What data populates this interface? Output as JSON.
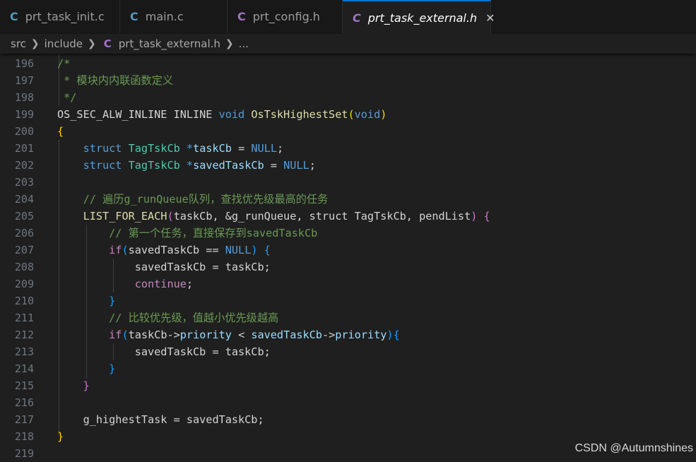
{
  "tabs": [
    {
      "icon": "C",
      "label": "prt_task_init.c",
      "active": false
    },
    {
      "icon": "C",
      "label": "main.c",
      "active": false
    },
    {
      "icon": "C",
      "label": "prt_config.h",
      "active": false
    },
    {
      "icon": "C",
      "label": "prt_task_external.h",
      "active": true,
      "close": "✕"
    }
  ],
  "breadcrumb": {
    "items": [
      "src",
      "include",
      "prt_task_external.h",
      "..."
    ],
    "file_icon": "C"
  },
  "editor": {
    "lines": [
      {
        "n": "196",
        "tokens": [
          [
            "c",
            "/*"
          ]
        ]
      },
      {
        "n": "197",
        "tokens": [
          [
            "c",
            " * 模块内内联函数定义"
          ]
        ]
      },
      {
        "n": "198",
        "tokens": [
          [
            "c",
            " */"
          ]
        ]
      },
      {
        "n": "199",
        "tokens": [
          [
            "p",
            "OS_SEC_ALW_INLINE INLINE "
          ],
          [
            "k",
            "void"
          ],
          [
            "p",
            " "
          ],
          [
            "f",
            "OsTskHighestSet"
          ],
          [
            "b1",
            "("
          ],
          [
            "k",
            "void"
          ],
          [
            "b1",
            ")"
          ]
        ]
      },
      {
        "n": "200",
        "tokens": [
          [
            "b1",
            "{"
          ]
        ]
      },
      {
        "n": "201",
        "tokens": [
          [
            "p",
            "    "
          ],
          [
            "k",
            "struct"
          ],
          [
            "p",
            " "
          ],
          [
            "t",
            "TagTskCb"
          ],
          [
            "p",
            " "
          ],
          [
            "k",
            "*"
          ],
          [
            "v",
            "taskCb"
          ],
          [
            "p",
            " = "
          ],
          [
            "k",
            "NULL"
          ],
          [
            "p",
            ";"
          ]
        ]
      },
      {
        "n": "202",
        "tokens": [
          [
            "p",
            "    "
          ],
          [
            "k",
            "struct"
          ],
          [
            "p",
            " "
          ],
          [
            "t",
            "TagTskCb"
          ],
          [
            "p",
            " "
          ],
          [
            "k",
            "*"
          ],
          [
            "v",
            "savedTaskCb"
          ],
          [
            "p",
            " = "
          ],
          [
            "k",
            "NULL"
          ],
          [
            "p",
            ";"
          ]
        ]
      },
      {
        "n": "203",
        "tokens": []
      },
      {
        "n": "204",
        "tokens": [
          [
            "p",
            "    "
          ],
          [
            "c",
            "// 遍历g_runQueue队列，查找优先级最高的任务"
          ]
        ]
      },
      {
        "n": "205",
        "tokens": [
          [
            "p",
            "    "
          ],
          [
            "f",
            "LIST_FOR_EACH"
          ],
          [
            "b2",
            "("
          ],
          [
            "p",
            "taskCb, &g_runQueue, struct TagTskCb, pendList"
          ],
          [
            "b2",
            ")"
          ],
          [
            "p",
            " "
          ],
          [
            "b2",
            "{"
          ]
        ]
      },
      {
        "n": "206",
        "tokens": [
          [
            "p",
            "        "
          ],
          [
            "c",
            "// 第一个任务，直接保存到savedTaskCb"
          ]
        ]
      },
      {
        "n": "207",
        "tokens": [
          [
            "p",
            "        "
          ],
          [
            "r",
            "if"
          ],
          [
            "b3",
            "("
          ],
          [
            "p",
            "savedTaskCb == "
          ],
          [
            "k",
            "NULL"
          ],
          [
            "b3",
            ")"
          ],
          [
            "p",
            " "
          ],
          [
            "b3",
            "{"
          ]
        ]
      },
      {
        "n": "208",
        "tokens": [
          [
            "p",
            "            savedTaskCb = taskCb;"
          ]
        ]
      },
      {
        "n": "209",
        "tokens": [
          [
            "p",
            "            "
          ],
          [
            "r",
            "continue"
          ],
          [
            "p",
            ";"
          ]
        ]
      },
      {
        "n": "210",
        "tokens": [
          [
            "p",
            "        "
          ],
          [
            "b3",
            "}"
          ]
        ]
      },
      {
        "n": "211",
        "tokens": [
          [
            "p",
            "        "
          ],
          [
            "c",
            "// 比较优先级，值越小优先级越高"
          ]
        ]
      },
      {
        "n": "212",
        "tokens": [
          [
            "p",
            "        "
          ],
          [
            "r",
            "if"
          ],
          [
            "b3",
            "("
          ],
          [
            "p",
            "taskCb->"
          ],
          [
            "v",
            "priority"
          ],
          [
            "p",
            " < "
          ],
          [
            "v",
            "savedTaskCb"
          ],
          [
            "p",
            "->"
          ],
          [
            "v",
            "priority"
          ],
          [
            "b3",
            ")"
          ],
          [
            "b3",
            "{"
          ]
        ]
      },
      {
        "n": "213",
        "tokens": [
          [
            "p",
            "            savedTaskCb = taskCb;"
          ]
        ]
      },
      {
        "n": "214",
        "tokens": [
          [
            "p",
            "        "
          ],
          [
            "b3",
            "}"
          ]
        ]
      },
      {
        "n": "215",
        "tokens": [
          [
            "p",
            "    "
          ],
          [
            "b2",
            "}"
          ]
        ]
      },
      {
        "n": "216",
        "tokens": []
      },
      {
        "n": "217",
        "tokens": [
          [
            "p",
            "    g_highestTask = savedTaskCb;"
          ]
        ]
      },
      {
        "n": "218",
        "tokens": [
          [
            "b1",
            "}"
          ]
        ]
      },
      {
        "n": "219",
        "tokens": []
      }
    ]
  },
  "watermark": "CSDN @Autumnshines",
  "colors": {
    "accent": "#0078d4",
    "c_icon_blue": "#519aba",
    "c_icon_purple": "#a074c4"
  }
}
